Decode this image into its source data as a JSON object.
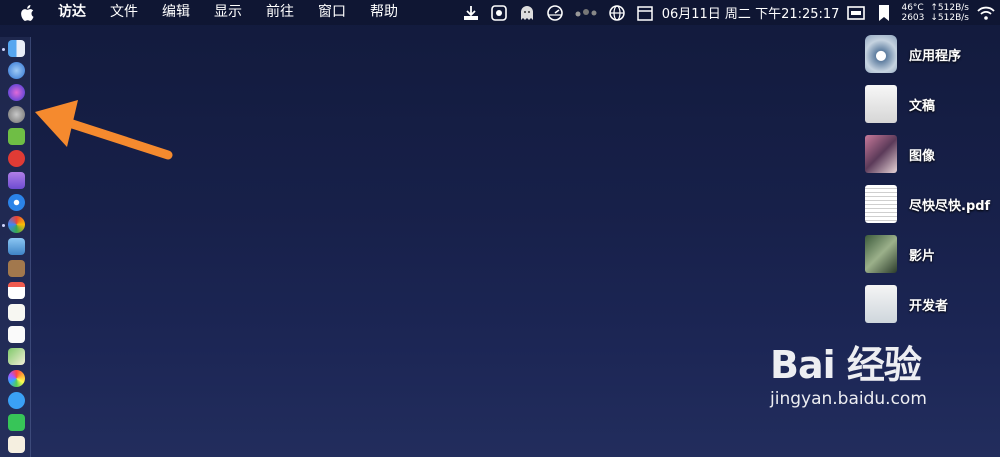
{
  "menubar": {
    "items": [
      "访达",
      "文件",
      "编辑",
      "显示",
      "前往",
      "窗口",
      "帮助"
    ],
    "status": {
      "clock": "06月11日 周二 下午21:25:17",
      "temp": "46°C",
      "fan": "2603",
      "upload": "↑512B/s",
      "download": "↓512B/s"
    }
  },
  "desktop": {
    "items": [
      {
        "label": "应用程序",
        "icon": "applications-folder-icon"
      },
      {
        "label": "文稿",
        "icon": "documents-folder-icon"
      },
      {
        "label": "图像",
        "icon": "pictures-folder-icon"
      },
      {
        "label": "尽快尽快.pdf",
        "icon": "pdf-file-icon"
      },
      {
        "label": "影片",
        "icon": "movies-folder-icon"
      },
      {
        "label": "开发者",
        "icon": "developer-folder-icon"
      }
    ]
  },
  "watermark": {
    "logo": "Bai 经验",
    "url": "jingyan.baidu.com"
  },
  "colors": {
    "arrow": "#f58a2e",
    "menubar": "#0f1633",
    "desktop": "#1a2350"
  }
}
